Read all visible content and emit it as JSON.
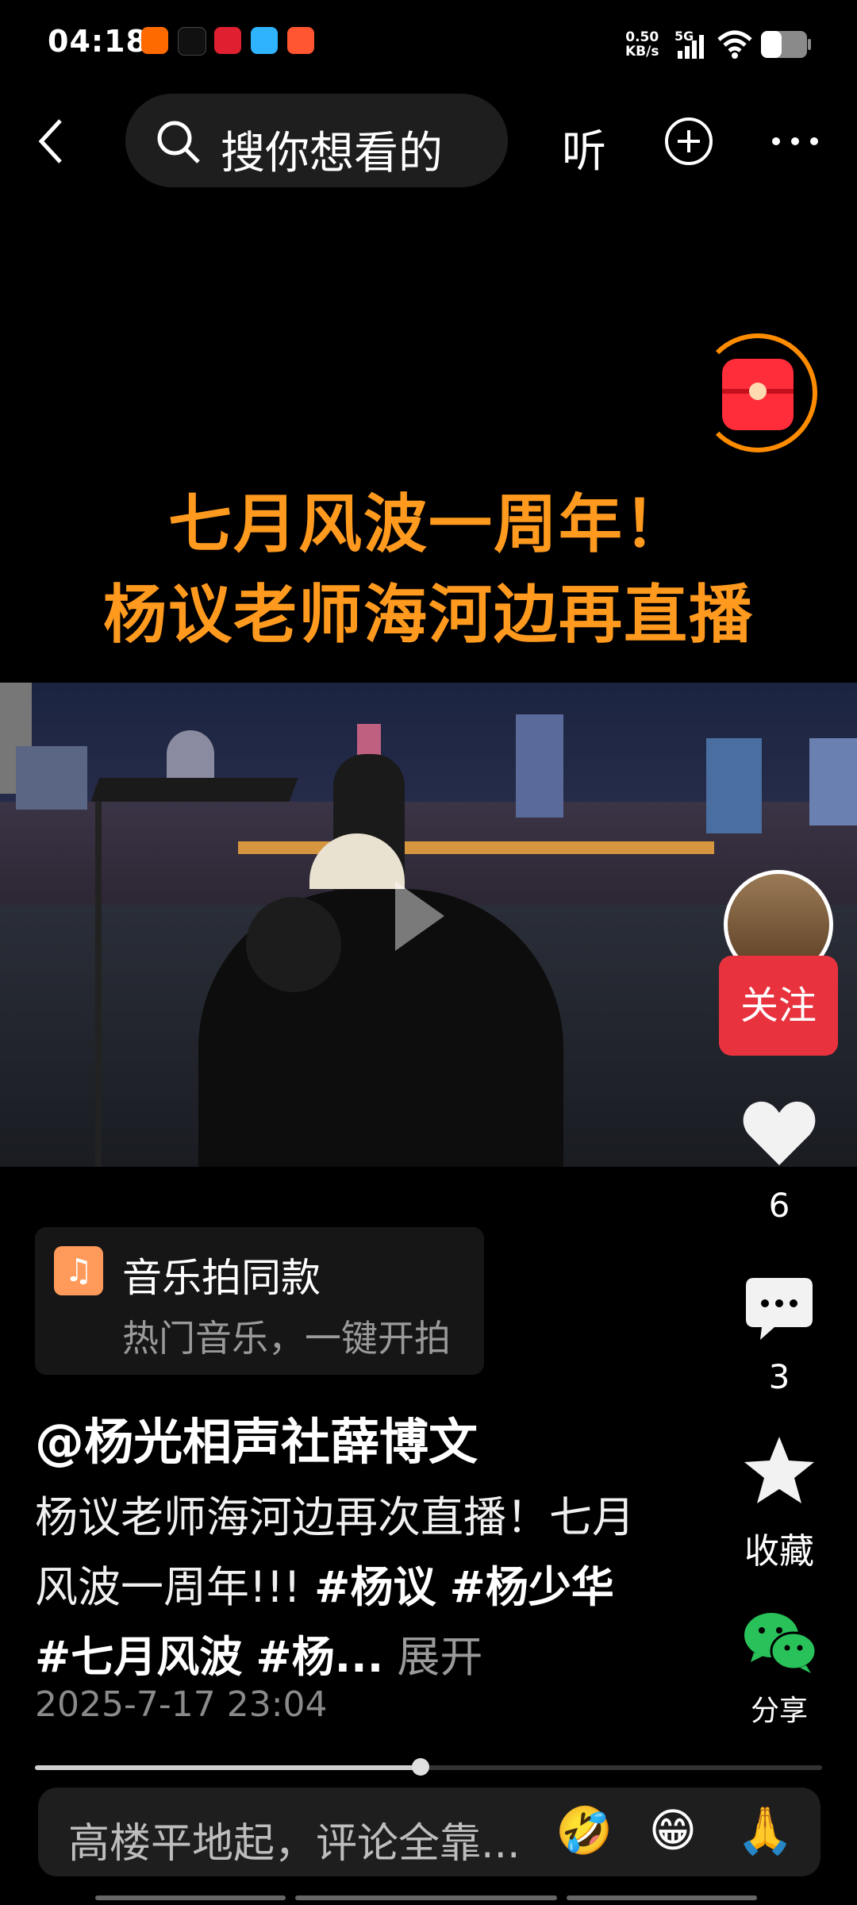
{
  "status_bar": {
    "time": "04:18",
    "net_speed": "0.50",
    "net_unit": "KB/s",
    "network": "5G"
  },
  "top_bar": {
    "search_placeholder": "搜你想看的",
    "listen_label": "听"
  },
  "video_title": {
    "line1": "七月风波一周年！",
    "line2": "杨议老师海河边再直播"
  },
  "right_rail": {
    "follow_label": "关注",
    "likes_count": "6",
    "comments_count": "3",
    "favorite_label": "收藏",
    "share_label": "分享"
  },
  "music_card": {
    "title": "音乐拍同款",
    "subtitle": "热门音乐，一键开拍"
  },
  "post": {
    "author": "@杨光相声社薛博文",
    "text": "杨议老师海河边再次直播！七月风波一周年!!!",
    "tag1": "#杨议",
    "tag2": "#杨少华",
    "tag3": "#七月风波",
    "tag4": "#杨...",
    "expand_label": "展开",
    "date": "2025-7-17 23:04"
  },
  "progress": {
    "played_fraction": 0.49
  },
  "comment_bar": {
    "placeholder": "高楼平地起，评论全靠...",
    "emoji1": "🤣",
    "emoji2": "😁",
    "emoji3": "🙏"
  },
  "colors": {
    "accent_orange": "#ff9a1f",
    "follow_red": "#e8333f",
    "wechat_green": "#29c15a"
  },
  "icons": [
    "back-icon",
    "search-icon",
    "plus-circle-icon",
    "more-icon",
    "red-packet-icon",
    "play-icon",
    "heart-icon",
    "comment-icon",
    "star-icon",
    "wechat-icon",
    "music-note-icon"
  ]
}
